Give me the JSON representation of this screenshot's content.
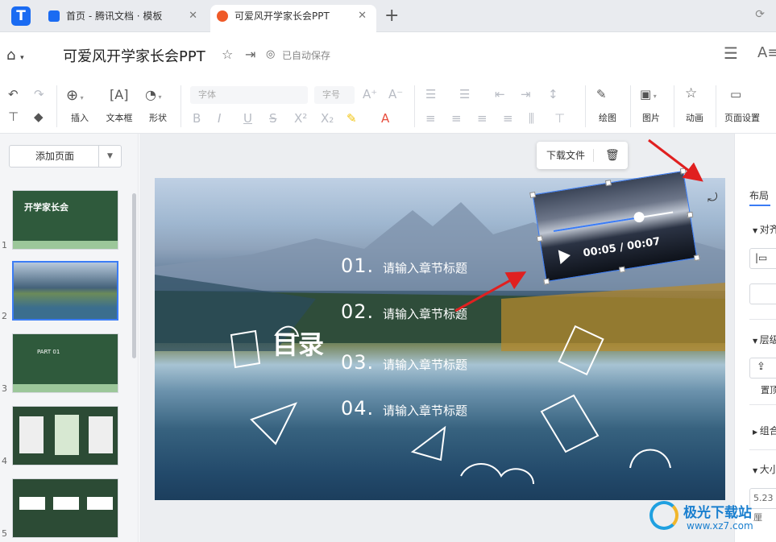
{
  "tabs": [
    {
      "label": "首页 - 腾讯文档 · 模板"
    },
    {
      "label": "可爱风开学家长会PPT"
    }
  ],
  "header": {
    "title": "可爱风开学家长会PPT",
    "save_status": "已自动保存"
  },
  "toolbar": {
    "insert": "插入",
    "textbox": "文本框",
    "shape": "形状",
    "font_placeholder": "字体",
    "size_placeholder": "字号",
    "draw": "绘图",
    "image": "图片",
    "animation": "动画",
    "page_setup": "页面设置"
  },
  "left_panel": {
    "add_page": "添加页面",
    "thumbs": [
      {
        "num": "1",
        "title": "开学家长会"
      },
      {
        "num": "2"
      },
      {
        "num": "3",
        "title": "PART 01"
      },
      {
        "num": "4"
      },
      {
        "num": "5"
      }
    ]
  },
  "slide": {
    "heading": "目录",
    "items": [
      {
        "num": "01.",
        "text": "请输入章节标题"
      },
      {
        "num": "02.",
        "text": "请输入章节标题"
      },
      {
        "num": "03.",
        "text": "请输入章节标题"
      },
      {
        "num": "04.",
        "text": "请输入章节标题"
      }
    ],
    "video_time": "00:05 / 00:07",
    "video_progress": 0.71
  },
  "floatbar": {
    "download": "下载文件"
  },
  "right_panel": {
    "tab": "布局",
    "sections": [
      "对齐",
      "层级",
      "组合",
      "大小"
    ],
    "layer_label": "置顶",
    "size_value": "5.23厘"
  },
  "watermark": {
    "name": "极光下载站",
    "url": "www.xz7.com"
  },
  "colors": {
    "accent": "#3b7cf5",
    "annotation_arrow": "#e02020"
  }
}
